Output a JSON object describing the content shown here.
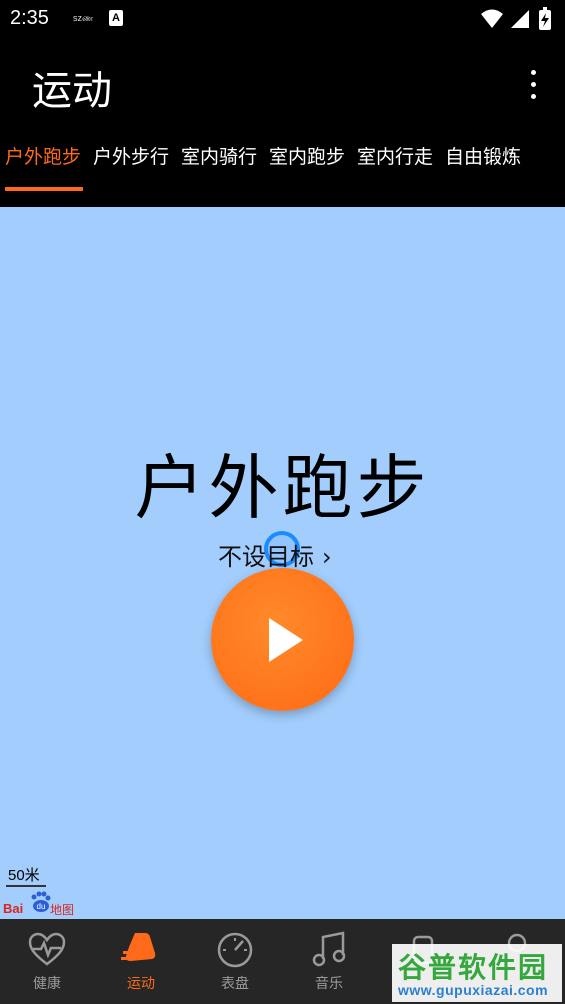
{
  "status_bar": {
    "time": "2:35",
    "small_text": "szண",
    "badge": "A",
    "icons": [
      "wifi-icon",
      "signal-icon",
      "battery-charging-icon"
    ]
  },
  "app_bar": {
    "title": "运动",
    "menu_icon": "more-vertical-icon"
  },
  "tabs": [
    {
      "label": "户外跑步",
      "active": true
    },
    {
      "label": "户外步行",
      "active": false
    },
    {
      "label": "室内骑行",
      "active": false
    },
    {
      "label": "室内跑步",
      "active": false
    },
    {
      "label": "室内行走",
      "active": false
    },
    {
      "label": "自由锻炼",
      "active": false
    }
  ],
  "main": {
    "activity_title": "户外跑步",
    "goal_label": "不设目标",
    "goal_chevron": "›",
    "start_button_icon": "play-icon"
  },
  "map": {
    "scale_label": "50米",
    "provider_text": "Bai",
    "provider_du": "du",
    "provider_suffix": "地图"
  },
  "bottom_nav": [
    {
      "label": "健康",
      "icon": "heart-pulse-icon",
      "active": false
    },
    {
      "label": "运动",
      "icon": "running-shoe-icon",
      "active": true
    },
    {
      "label": "表盘",
      "icon": "gauge-icon",
      "active": false
    },
    {
      "label": "音乐",
      "icon": "music-note-icon",
      "active": false
    },
    {
      "label": "",
      "icon": "watch-icon",
      "active": false
    },
    {
      "label": "",
      "icon": "profile-icon",
      "active": false
    }
  ],
  "watermark": {
    "title": "谷普软件园",
    "url": "www.gupuxiazai.com"
  },
  "colors": {
    "accent": "#ff6a1a",
    "map_background": "#a2cdfd",
    "nav_background": "#262626",
    "inactive": "#9a9a9a"
  }
}
